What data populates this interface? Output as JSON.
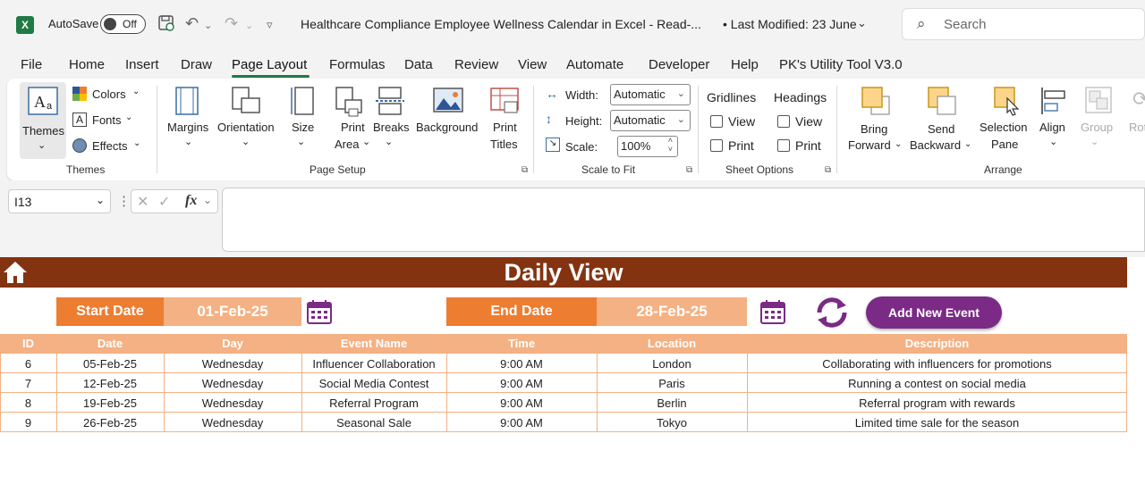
{
  "titlebar": {
    "autosave_label": "AutoSave",
    "toggle_state": "Off",
    "doc_title": "Healthcare Compliance Employee Wellness Calendar in Excel  -  Read-...",
    "last_modified": "• Last Modified: 23 June",
    "search_placeholder": "Search"
  },
  "menu": [
    "File",
    "Home",
    "Insert",
    "Draw",
    "Page Layout",
    "Formulas",
    "Data",
    "Review",
    "View",
    "Automate",
    "Developer",
    "Help",
    "PK's Utility Tool V3.0"
  ],
  "ribbon": {
    "themes": {
      "label": "Themes",
      "colors": "Colors",
      "fonts": "Fonts",
      "effects": "Effects",
      "group": "Themes"
    },
    "page_setup": {
      "margins": "Margins",
      "orientation": "Orientation",
      "size": "Size",
      "print_area_1": "Print",
      "print_area_2": "Area",
      "breaks": "Breaks",
      "background": "Background",
      "print_titles_1": "Print",
      "print_titles_2": "Titles",
      "group": "Page Setup"
    },
    "scale_to_fit": {
      "width_label": "Width:",
      "width_value": "Automatic",
      "height_label": "Height:",
      "height_value": "Automatic",
      "scale_label": "Scale:",
      "scale_value": "100%",
      "group": "Scale to Fit"
    },
    "sheet_options": {
      "gridlines": "Gridlines",
      "headings": "Headings",
      "view": "View",
      "print": "Print",
      "group": "Sheet Options"
    },
    "arrange": {
      "bring_1": "Bring",
      "bring_2": "Forward",
      "send_1": "Send",
      "send_2": "Backward",
      "selection_1": "Selection",
      "selection_2": "Pane",
      "align": "Align",
      "group_btn": "Group",
      "rotate": "Rota",
      "group": "Arrange"
    }
  },
  "formula_bar": {
    "name_box": "I13",
    "fx": "fx",
    "formula": ""
  },
  "sheet": {
    "title": "Daily View",
    "start_label": "Start Date",
    "start_value": "01-Feb-25",
    "end_label": "End Date",
    "end_value": "28-Feb-25",
    "add_button": "Add New Event",
    "columns": [
      "ID",
      "Date",
      "Day",
      "Event Name",
      "Time",
      "Location",
      "Description"
    ],
    "rows": [
      [
        "6",
        "05-Feb-25",
        "Wednesday",
        "Influencer Collaboration",
        "9:00 AM",
        "London",
        "Collaborating with influencers for promotions"
      ],
      [
        "7",
        "12-Feb-25",
        "Wednesday",
        "Social Media Contest",
        "9:00 AM",
        "Paris",
        "Running a contest on social media"
      ],
      [
        "8",
        "19-Feb-25",
        "Wednesday",
        "Referral Program",
        "9:00 AM",
        "Berlin",
        "Referral program with rewards"
      ],
      [
        "9",
        "26-Feb-25",
        "Wednesday",
        "Seasonal Sale",
        "9:00 AM",
        "Tokyo",
        "Limited time sale for the season"
      ]
    ]
  },
  "colors": {
    "header_band": "#843310",
    "orange": "#ed7d31",
    "light_orange": "#f4b183",
    "purple": "#7b2a85",
    "excel_green": "#1f7a45"
  }
}
